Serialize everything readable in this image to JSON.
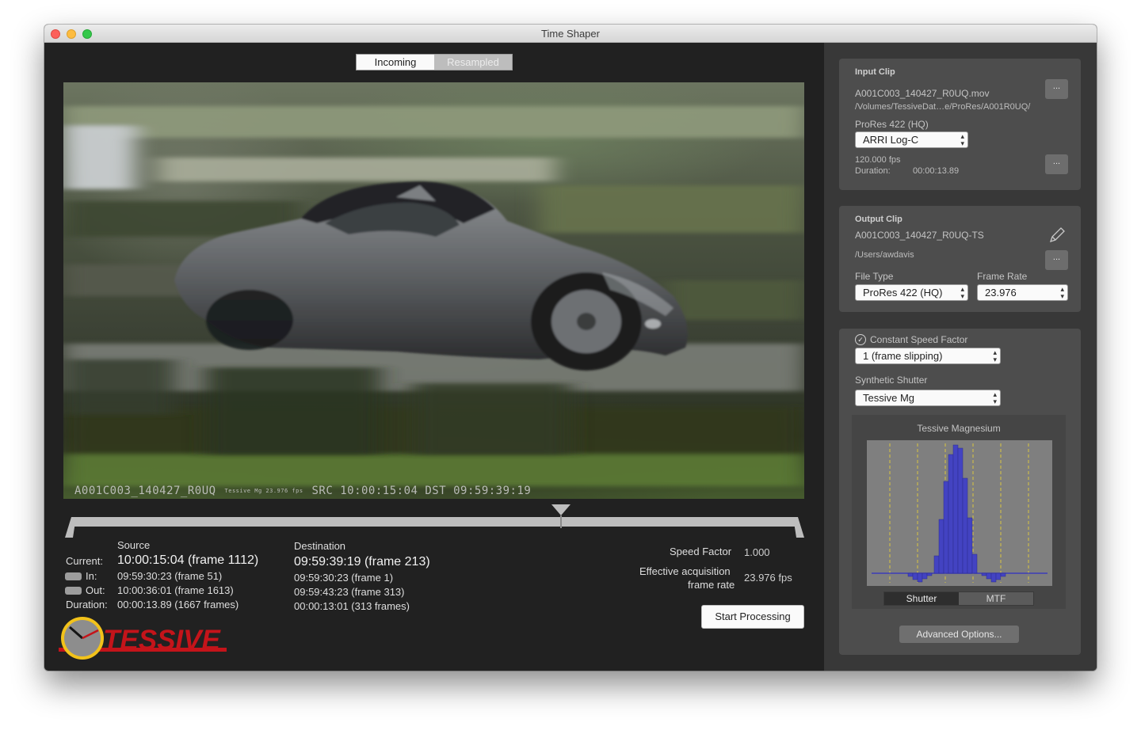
{
  "window": {
    "title": "Time Shaper"
  },
  "view_toggle": {
    "incoming": "Incoming",
    "resampled": "Resampled",
    "selected": "Incoming"
  },
  "video": {
    "clip_name": "A001C003_140427_R0UQ",
    "badge_line1": "Tessive Mg",
    "badge_line2": "23.976 fps",
    "src_label": "SRC",
    "src_tc": "10:00:15:04",
    "dst_label": "DST",
    "dst_tc": "09:59:39:19"
  },
  "source": {
    "header": "Source",
    "current_label": "Current:",
    "current": "10:00:15:04 (frame 1112)",
    "in_label": "In:",
    "in": "09:59:30:23 (frame 51)",
    "out_label": "Out:",
    "out": "10:00:36:01 (frame 1613)",
    "duration_label": "Duration:",
    "duration": "00:00:13.89 (1667 frames)"
  },
  "destination": {
    "header": "Destination",
    "current": "09:59:39:19 (frame 213)",
    "in": "09:59:30:23 (frame 1)",
    "out": "09:59:43:23 (frame 313)",
    "duration": "00:00:13:01 (313 frames)"
  },
  "speed": {
    "speed_label": "Speed Factor",
    "speed_value": "1.000",
    "acq_label_1": "Effective acquisition",
    "acq_label_2": "frame rate",
    "acq_value": "23.976 fps"
  },
  "start_button": "Start Processing",
  "logo_text": "TESSIVE",
  "input_clip": {
    "header": "Input Clip",
    "filename": "A001C003_140427_R0UQ.mov",
    "path": "/Volumes/TessiveDat…e/ProRes/A001R0UQ/",
    "codec": "ProRes 422 (HQ)",
    "colorspace": "ARRI Log-C",
    "fps": "120.000 fps",
    "duration_label": "Duration:",
    "duration": "00:00:13.89",
    "dots": "..."
  },
  "output_clip": {
    "header": "Output Clip",
    "filename": "A001C003_140427_R0UQ-TS",
    "path": "/Users/awdavis",
    "file_type_label": "File Type",
    "file_type": "ProRes 422 (HQ)",
    "frame_rate_label": "Frame Rate",
    "frame_rate": "23.976",
    "dots": "..."
  },
  "settings": {
    "constant_speed_label": "Constant Speed Factor",
    "constant_speed_checked": true,
    "speed_mode": "1 (frame slipping)",
    "shutter_label": "Synthetic Shutter",
    "shutter": "Tessive Mg",
    "plot_title": "Tessive Magnesium",
    "tab_shutter": "Shutter",
    "tab_mtf": "MTF",
    "tab_selected": "Shutter",
    "advanced_button": "Advanced Options..."
  },
  "colors": {
    "window_bg": "#212121",
    "side_bg": "#383838",
    "plot_bar": "#3d3db8",
    "plot_guide": "#d9c542",
    "logo_red": "#c4141a",
    "logo_yellow": "#f2c21a"
  }
}
